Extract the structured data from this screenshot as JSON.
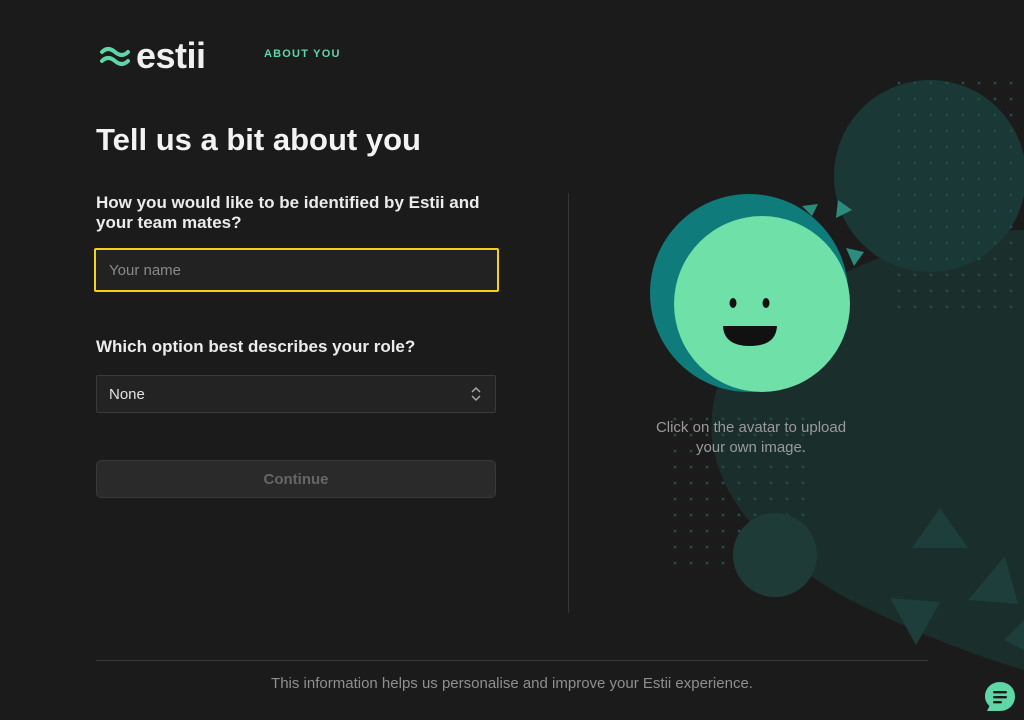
{
  "brand": {
    "name": "estii",
    "accent_color": "#5fd6a6",
    "logo_icon": "wave-icon"
  },
  "header": {
    "step_label": "ABOUT YOU"
  },
  "main": {
    "title": "Tell us a bit about you",
    "name_question": "How you would like to be identified by Estii and your team mates?",
    "name_input": {
      "value": "",
      "placeholder": "Your name",
      "focus_color": "#f2d21b"
    },
    "role_question": "Which option best describes your role?",
    "role_select": {
      "selected": "None",
      "icon": "chevron-updown-icon"
    },
    "continue_label": "Continue"
  },
  "avatar": {
    "icon": "smiley-face-icon",
    "face_color": "#6ee0a8",
    "hint": "Click on the avatar to upload your own image."
  },
  "footer": {
    "text": "This information helps us personalise and improve your Estii experience."
  },
  "chat": {
    "icon": "chat-bubble-icon",
    "color": "#5fd6a6"
  }
}
